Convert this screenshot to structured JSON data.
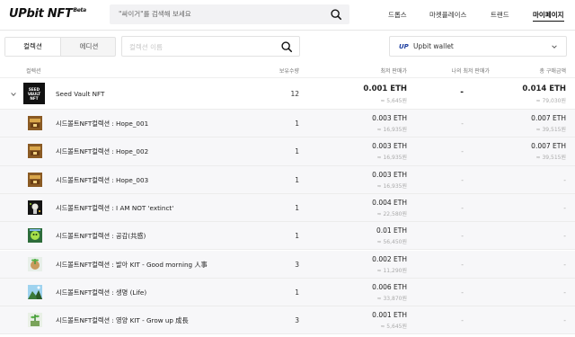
{
  "header": {
    "logo": "UPbit NFT",
    "logo_beta": "Beta",
    "search_placeholder": "\"싸이거\"를 검색해 보세요",
    "nav": [
      "드롭스",
      "마켓플레이스",
      "트랜드",
      "마이페이지"
    ]
  },
  "toolbar": {
    "tabs": [
      "컬렉션",
      "에디션"
    ],
    "filter_placeholder": "컬렉션 이름",
    "wallet_mark": "UP",
    "wallet_name": "Upbit wallet"
  },
  "table": {
    "headers": [
      "컬렉션",
      "보유수량",
      "최저 판매가",
      "나의 최저 판매가",
      "총 구매금액"
    ],
    "parent": {
      "thumb_text": "SEED VAULT NFT",
      "name": "Seed Vault NFT",
      "qty": "12",
      "price": "0.001 ETH",
      "price_krw": "≈ 5,645원",
      "my_price": "-",
      "total": "0.014 ETH",
      "total_krw": "≈ 79,030원"
    },
    "rows": [
      {
        "name": "시드볼트NFT컬렉션 : Hope_001",
        "qty": "1",
        "price": "0.003 ETH",
        "price_krw": "≈ 16,935원",
        "my_price": "-",
        "total": "0.007 ETH",
        "total_krw": "≈ 39,515원",
        "thumb": "hope"
      },
      {
        "name": "시드볼트NFT컬렉션 : Hope_002",
        "qty": "1",
        "price": "0.003 ETH",
        "price_krw": "≈ 16,935원",
        "my_price": "-",
        "total": "0.007 ETH",
        "total_krw": "≈ 39,515원",
        "thumb": "hope"
      },
      {
        "name": "시드볼트NFT컬렉션 : Hope_003",
        "qty": "1",
        "price": "0.003 ETH",
        "price_krw": "≈ 16,935원",
        "my_price": "-",
        "total": "-",
        "total_krw": "",
        "thumb": "hope"
      },
      {
        "name": "시드볼트NFT컬렉션 : I AM NOT 'extinct'",
        "qty": "1",
        "price": "0.004 ETH",
        "price_krw": "≈ 22,580원",
        "my_price": "-",
        "total": "-",
        "total_krw": "",
        "thumb": "extinct"
      },
      {
        "name": "시드볼트NFT컬렉션 : 공감(共感)",
        "qty": "1",
        "price": "0.01 ETH",
        "price_krw": "≈ 56,450원",
        "my_price": "-",
        "total": "-",
        "total_krw": "",
        "thumb": "empathy"
      },
      {
        "name": "시드볼트NFT컬렉션 : 발아 KIT - Good morning 人事",
        "qty": "3",
        "price": "0.002 ETH",
        "price_krw": "≈ 11,290원",
        "my_price": "-",
        "total": "-",
        "total_krw": "",
        "thumb": "sprout"
      },
      {
        "name": "시드볼트NFT컬렉션 : 생명 (Life)",
        "qty": "1",
        "price": "0.006 ETH",
        "price_krw": "≈ 33,870원",
        "my_price": "-",
        "total": "-",
        "total_krw": "",
        "thumb": "life"
      },
      {
        "name": "시드볼트NFT컬렉션 : 영양 KIT - Grow up 成長",
        "qty": "3",
        "price": "0.001 ETH",
        "price_krw": "≈ 5,645원",
        "my_price": "-",
        "total": "-",
        "total_krw": "",
        "thumb": "grow"
      }
    ]
  }
}
